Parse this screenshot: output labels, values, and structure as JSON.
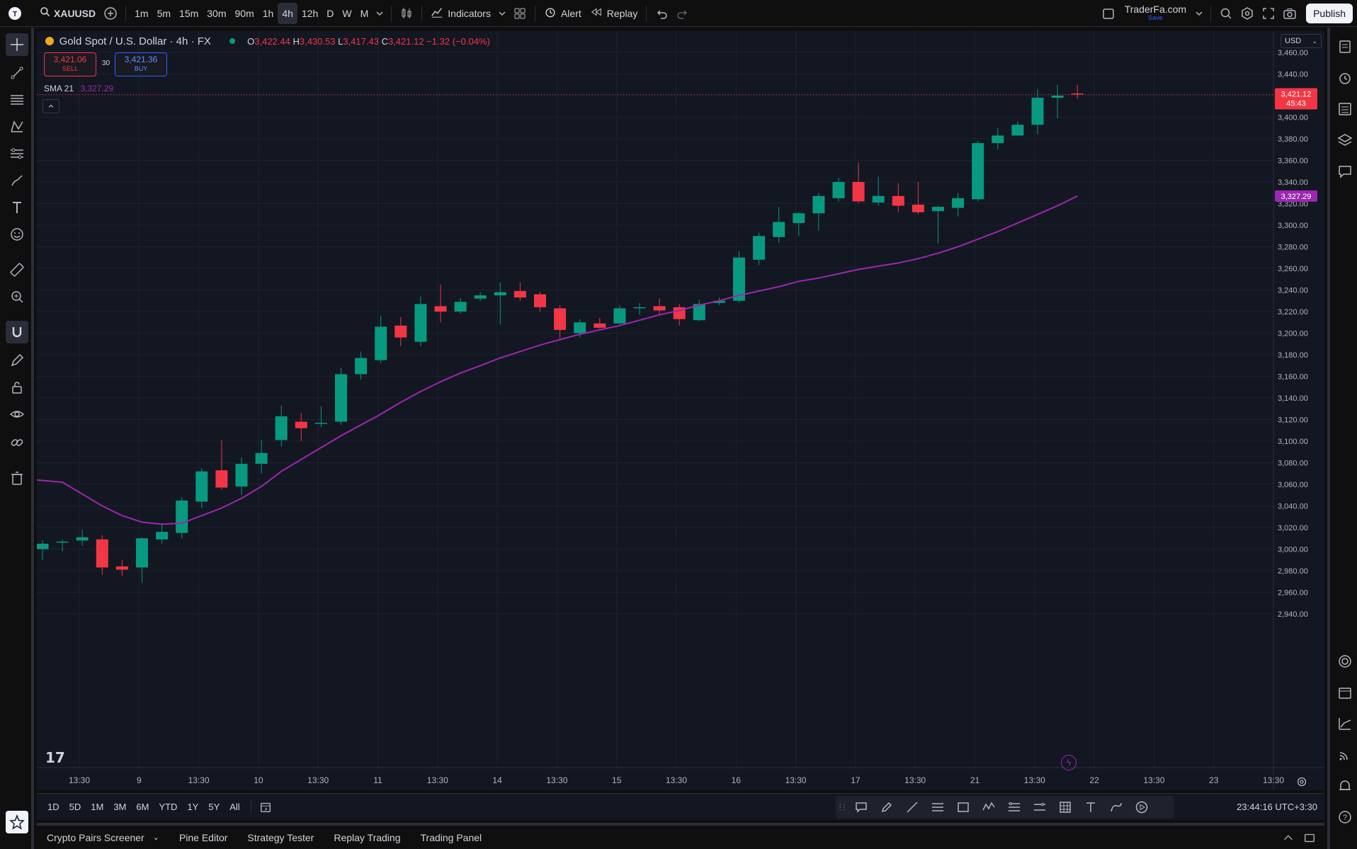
{
  "topbar": {
    "symbol": "XAUUSD",
    "intervals": [
      "1m",
      "5m",
      "15m",
      "30m",
      "90m",
      "1h",
      "4h",
      "12h",
      "D",
      "W",
      "M"
    ],
    "active_interval": "4h",
    "indicators_label": "Indicators",
    "alert_label": "Alert",
    "replay_label": "Replay",
    "site_name": "TraderFa.com",
    "site_sub": "Save",
    "publish_label": "Publish"
  },
  "legend": {
    "title": "Gold Spot / U.S. Dollar · 4h · FX",
    "o_label": "O",
    "o_value": "3,422.44",
    "h_label": "H",
    "h_value": "3,430.53",
    "l_label": "L",
    "l_value": "3,417.43",
    "c_label": "C",
    "c_value": "3,421.12",
    "change": "−1.32 (−0.04%)",
    "sell_price": "3,421.06",
    "sell_label": "SELL",
    "spread": "30",
    "buy_price": "3,421.36",
    "buy_label": "BUY",
    "sma_label": "SMA 21",
    "sma_value": "3,327.29"
  },
  "price_axis": {
    "currency": "USD",
    "labels": [
      "3,460.00",
      "3,440.00",
      "3,420.00",
      "3,400.00",
      "3,380.00",
      "3,360.00",
      "3,340.00",
      "3,320.00",
      "3,300.00",
      "3,280.00",
      "3,260.00",
      "3,240.00",
      "3,220.00",
      "3,200.00",
      "3,180.00",
      "3,160.00",
      "3,140.00",
      "3,120.00",
      "3,100.00",
      "3,080.00",
      "3,060.00",
      "3,040.00",
      "3,020.00",
      "3,000.00",
      "2,980.00",
      "2,960.00",
      "2,940.00"
    ],
    "last_price": "3,421.12",
    "countdown": "45:43",
    "sma_tag": "3,327.29"
  },
  "time_axis": {
    "labels": [
      "13:30",
      "9",
      "13:30",
      "10",
      "13:30",
      "11",
      "13:30",
      "14",
      "13:30",
      "15",
      "13:30",
      "16",
      "13:30",
      "17",
      "13:30",
      "21",
      "13:30",
      "22",
      "13:30",
      "23",
      "13:30"
    ]
  },
  "bottombar": {
    "ranges": [
      "1D",
      "5D",
      "1M",
      "3M",
      "6M",
      "YTD",
      "1Y",
      "5Y",
      "All"
    ],
    "clock": "23:44:16 UTC+3:30"
  },
  "panels": [
    "Crypto Pairs Screener",
    "Pine Editor",
    "Strategy Tester",
    "Replay Trading",
    "Trading Panel"
  ],
  "colors": {
    "up": "#089981",
    "down": "#f23645",
    "sma": "#9c27b0",
    "bg": "#131722"
  },
  "chart_data": {
    "type": "candlestick",
    "title": "Gold Spot / U.S. Dollar · 4h · FX",
    "ylim": [
      2930,
      3470
    ],
    "series": [
      {
        "name": "XAUUSD",
        "ohlc": [
          [
            3000,
            3008,
            2990,
            3005
          ],
          [
            3006,
            3009,
            2998,
            3007
          ],
          [
            3008,
            3018,
            3003,
            3011
          ],
          [
            3009,
            3013,
            2976,
            2983
          ],
          [
            2984,
            2990,
            2975,
            2981
          ],
          [
            2983,
            3011,
            2969,
            3010
          ],
          [
            3009,
            3024,
            3005,
            3016
          ],
          [
            3015,
            3048,
            3010,
            3045
          ],
          [
            3044,
            3075,
            3038,
            3072
          ],
          [
            3073,
            3101,
            3055,
            3057
          ],
          [
            3058,
            3085,
            3050,
            3079
          ],
          [
            3079,
            3101,
            3070,
            3089
          ],
          [
            3101,
            3133,
            3095,
            3123
          ],
          [
            3118,
            3126,
            3100,
            3112
          ],
          [
            3116,
            3132,
            3113,
            3117
          ],
          [
            3118,
            3168,
            3115,
            3162
          ],
          [
            3162,
            3183,
            3157,
            3177
          ],
          [
            3175,
            3216,
            3172,
            3206
          ],
          [
            3207,
            3215,
            3188,
            3196
          ],
          [
            3192,
            3234,
            3188,
            3227
          ],
          [
            3225,
            3245,
            3210,
            3220
          ],
          [
            3220,
            3233,
            3218,
            3229
          ],
          [
            3232,
            3238,
            3230,
            3235
          ],
          [
            3235,
            3247,
            3208,
            3238
          ],
          [
            3239,
            3247,
            3230,
            3233
          ],
          [
            3236,
            3238,
            3220,
            3224
          ],
          [
            3223,
            3226,
            3195,
            3203
          ],
          [
            3200,
            3213,
            3196,
            3210
          ],
          [
            3209,
            3214,
            3204,
            3205
          ],
          [
            3209,
            3226,
            3208,
            3223
          ],
          [
            3223,
            3228,
            3217,
            3224
          ],
          [
            3225,
            3232,
            3217,
            3221
          ],
          [
            3224,
            3227,
            3207,
            3213
          ],
          [
            3212,
            3231,
            3211,
            3227
          ],
          [
            3228,
            3233,
            3226,
            3230
          ],
          [
            3230,
            3276,
            3228,
            3270
          ],
          [
            3268,
            3293,
            3263,
            3290
          ],
          [
            3289,
            3317,
            3284,
            3303
          ],
          [
            3302,
            3312,
            3290,
            3311
          ],
          [
            3311,
            3330,
            3295,
            3327
          ],
          [
            3325,
            3344,
            3322,
            3340
          ],
          [
            3340,
            3358,
            3320,
            3322
          ],
          [
            3321,
            3345,
            3318,
            3327
          ],
          [
            3327,
            3339,
            3312,
            3318
          ],
          [
            3319,
            3340,
            3310,
            3312
          ],
          [
            3313,
            3318,
            3283,
            3317
          ],
          [
            3316,
            3330,
            3308,
            3325
          ],
          [
            3324,
            3378,
            3322,
            3376
          ],
          [
            3376,
            3390,
            3370,
            3383
          ],
          [
            3383,
            3396,
            3383,
            3393
          ],
          [
            3393,
            3426,
            3384,
            3418
          ],
          [
            3418,
            3430,
            3399,
            3420
          ],
          [
            3422,
            3430,
            3417,
            3421
          ]
        ]
      },
      {
        "name": "SMA 21",
        "values": [
          3062,
          3051,
          3040,
          3031,
          3025,
          3023,
          3024,
          3031,
          3038,
          3047,
          3058,
          3072,
          3083,
          3094,
          3105,
          3115,
          3125,
          3136,
          3146,
          3155,
          3163,
          3170,
          3177,
          3183,
          3189,
          3194,
          3199,
          3203,
          3207,
          3212,
          3217,
          3221,
          3226,
          3230,
          3235,
          3239,
          3243,
          3248,
          3251,
          3255,
          3259,
          3262,
          3265,
          3269,
          3274,
          3280,
          3287,
          3294,
          3302,
          3310,
          3318,
          3327
        ]
      }
    ]
  }
}
